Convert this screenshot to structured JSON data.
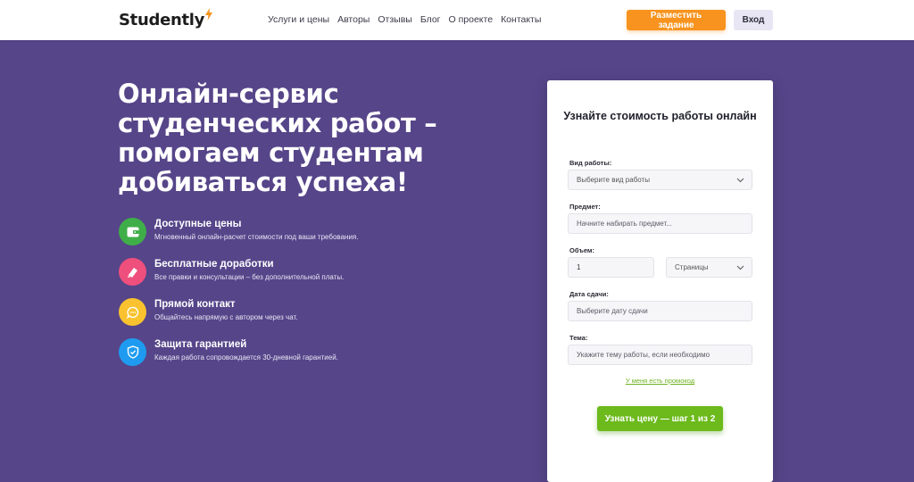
{
  "header": {
    "logo_text": "Studently",
    "nav": [
      "Услуги и цены",
      "Авторы",
      "Отзывы",
      "Блог",
      "О проекте",
      "Контакты"
    ],
    "post_task_label": "Разместить задание",
    "login_label": "Вход"
  },
  "hero": {
    "title": "Онлайн-сервис студенческих работ – помогаем студентам добиваться успеха!",
    "features": [
      {
        "title": "Доступные цены",
        "desc": "Мгновенный онлайн-расчет стоимости под ваши требования.",
        "icon": "wallet-icon",
        "color": "#3fae49"
      },
      {
        "title": "Бесплатные доработки",
        "desc": "Все правки и консультации – без дополнительной платы.",
        "icon": "eraser-icon",
        "color": "#ee4f7c"
      },
      {
        "title": "Прямой контакт",
        "desc": "Общайтесь напрямую с автором через чат.",
        "icon": "chat-icon",
        "color": "#f9c22e"
      },
      {
        "title": "Защита гарантией",
        "desc": "Каждая работа сопровождается 30-дневной гарантией.",
        "icon": "shield-check-icon",
        "color": "#1e9bf0"
      }
    ]
  },
  "form": {
    "title": "Узнайте стоимость работы онлайн",
    "work_type_label": "Вид работы:",
    "work_type_value": "Выберите вид работы",
    "subject_label": "Предмет:",
    "subject_placeholder": "Начните набирать предмет...",
    "volume_label": "Объем:",
    "volume_value": "1",
    "volume_unit": "Страницы",
    "deadline_label": "Дата сдачи:",
    "deadline_placeholder": "Выберите дату сдачи",
    "topic_label": "Тема:",
    "topic_placeholder": "Укажите тему работы, если необходимо",
    "promo_label": "У меня есть промокод",
    "submit_label": "Узнать цену — шаг 1 из 2"
  },
  "colors": {
    "background": "#564589",
    "accent_orange": "#f7931e",
    "accent_green": "#6cba1c"
  }
}
